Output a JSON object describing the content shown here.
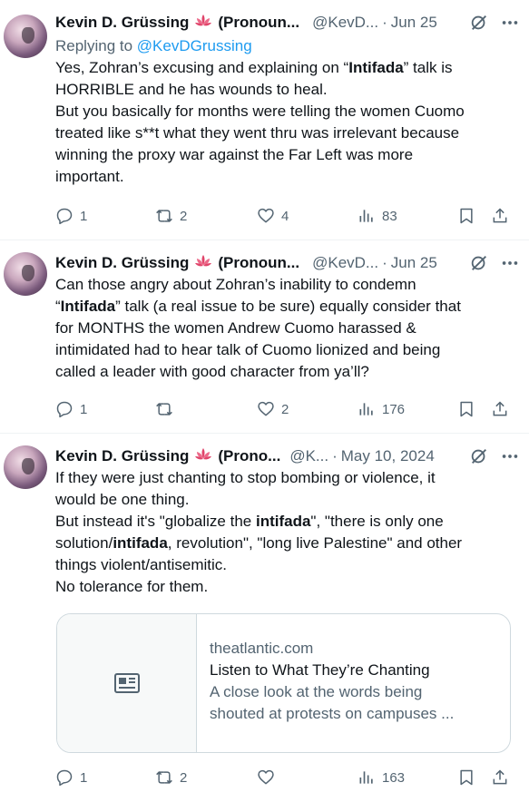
{
  "tweets": [
    {
      "author_name": "Kevin D. Grüssing",
      "author_suffix": "(Pronoun...",
      "handle": "@KevD...",
      "date": "Jun 25",
      "replying_prefix": "Replying to",
      "replying_handle": "@KevDGrussing",
      "lines": [
        [
          "Yes, Zohran’s excusing and explaining on “",
          "Intifada",
          "” talk is"
        ],
        [
          "HORRIBLE and he has wounds to heal."
        ],
        [
          "But you basically for months were telling the women Cuomo"
        ],
        [
          "treated like s**t what they went thru was irrelevant because"
        ],
        [
          "winning the proxy war against the Far Left was more"
        ],
        [
          "important."
        ]
      ],
      "replies": "1",
      "reposts": "2",
      "likes": "4",
      "views": "83"
    },
    {
      "author_name": "Kevin D. Grüssing",
      "author_suffix": "(Pronoun...",
      "handle": "@KevD...",
      "date": "Jun 25",
      "lines": [
        [
          "Can those angry about Zohran’s inability to condemn"
        ],
        [
          "“",
          "Intifada",
          "” talk (a real issue to be sure) equally consider that"
        ],
        [
          "for MONTHS the women Andrew Cuomo harassed &"
        ],
        [
          "intimidated had to hear talk of Cuomo lionized and being"
        ],
        [
          "called a leader with good character from ya’ll?"
        ]
      ],
      "replies": "1",
      "reposts": "",
      "likes": "2",
      "views": "176"
    },
    {
      "author_name": "Kevin D. Grüssing",
      "author_suffix": "(Prono...",
      "handle": "@K...",
      "date": "May 10, 2024",
      "lines": [
        [
          "If they were just chanting to stop bombing or violence, it"
        ],
        [
          "would be one thing."
        ],
        [
          "But instead it's \"globalize the ",
          "intifada",
          "\", \"there is only one"
        ],
        [
          "solution/",
          "intifada",
          ", revolution\", \"long live Palestine\" and other"
        ],
        [
          "things violent/antisemitic."
        ],
        [
          "No tolerance for them."
        ]
      ],
      "card": {
        "domain": "theatlantic.com",
        "title": "Listen to What They’re Chanting",
        "description_lines": [
          "A close look at the words being",
          "shouted at protests on campuses ..."
        ]
      },
      "replies": "1",
      "reposts": "2",
      "likes": "",
      "views": "163"
    }
  ],
  "icons": {
    "lotus": "lotus-emoji-icon",
    "grok": "grok-icon",
    "more": "more-icon",
    "reply": "reply-icon",
    "repost": "repost-icon",
    "like": "heart-icon",
    "views": "views-icon",
    "bookmark": "bookmark-icon",
    "share": "share-icon",
    "article": "article-icon"
  },
  "colors": {
    "text": "#0f1419",
    "secondary": "#536471",
    "link": "#1d9bf0",
    "border": "#cfd9de",
    "lotus": "#e0446a"
  }
}
